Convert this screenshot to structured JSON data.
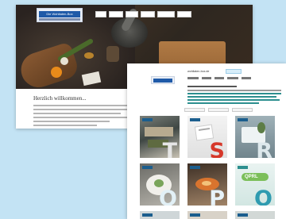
{
  "back_page": {
    "logo_text": "Die Wohltaten-Box",
    "nav_items": 6,
    "intro_title": "Herzlich willkommen..."
  },
  "front_page": {
    "site_name": "wohltaten-box.de"
  },
  "tiles": [
    {
      "letter": "T",
      "scene": "kitchen"
    },
    {
      "letter": "S",
      "scene": "paper"
    },
    {
      "letter": "R",
      "scene": "plant"
    },
    {
      "letter": "Q",
      "scene": "plate"
    },
    {
      "letter": "P",
      "scene": "food"
    },
    {
      "letter": "O",
      "scene": "logo"
    }
  ],
  "colors": {
    "background": "#c3e3f4",
    "brand_blue": "#1f5aa8",
    "tile_label": "#1b5e8e",
    "teal_text": "#2d8f8f"
  }
}
